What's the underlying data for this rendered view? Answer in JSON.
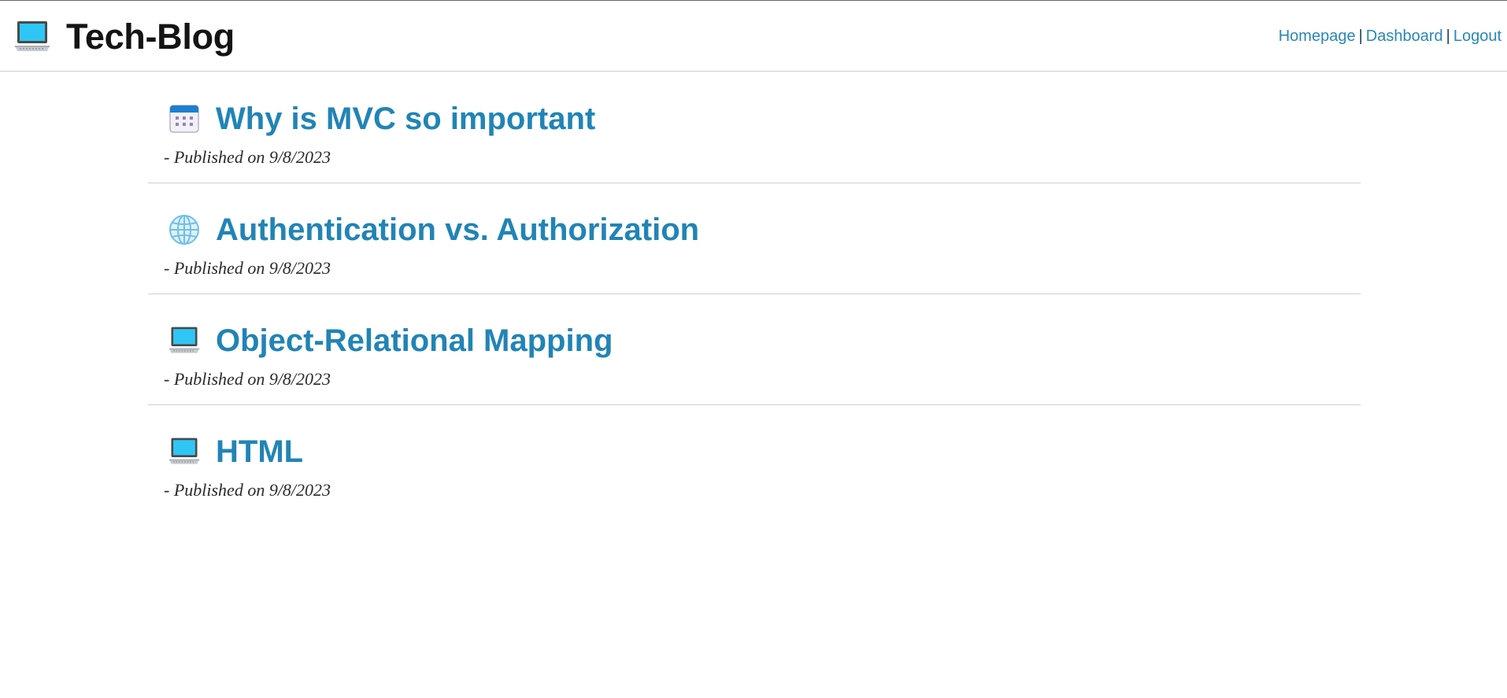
{
  "site": {
    "title": "Tech-Blog",
    "logo_icon": "laptop-icon"
  },
  "nav": {
    "homepage": "Homepage",
    "dashboard": "Dashboard",
    "logout": "Logout",
    "separator": "|"
  },
  "colors": {
    "link": "#2184b6",
    "title_text": "#141414",
    "divider": "#d0d0d0"
  },
  "posts": [
    {
      "title": "Why is MVC so important",
      "meta": "- Published on 9/8/2023",
      "icon": "calendar-icon"
    },
    {
      "title": "Authentication vs. Authorization",
      "meta": "- Published on 9/8/2023",
      "icon": "globe-icon"
    },
    {
      "title": "Object-Relational Mapping",
      "meta": "- Published on 9/8/2023",
      "icon": "laptop-icon"
    },
    {
      "title": "HTML",
      "meta": "- Published on 9/8/2023",
      "icon": "laptop-icon"
    }
  ]
}
